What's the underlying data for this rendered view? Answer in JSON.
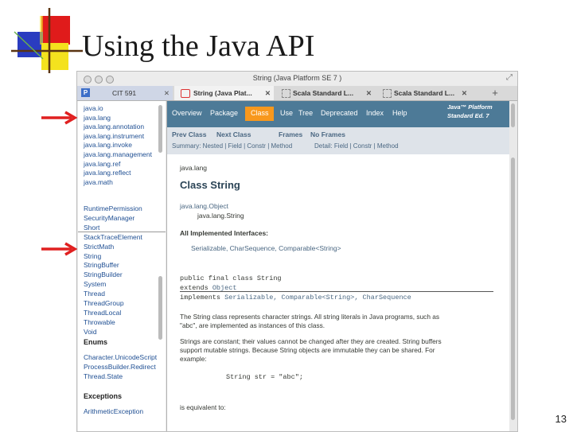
{
  "slide": {
    "title": "Using the Java API",
    "page_number": "13"
  },
  "browser": {
    "window_title": "String (Java Platform SE 7 )",
    "tabs": [
      {
        "label": "CIT 591"
      },
      {
        "label": "String (Java Plat..."
      },
      {
        "label": "Scala Standard L..."
      },
      {
        "label": "Scala Standard L..."
      }
    ],
    "new_tab": "+",
    "package_list": [
      "java.io",
      "java.lang",
      "java.lang.annotation",
      "java.lang.instrument",
      "java.lang.invoke",
      "java.lang.management",
      "java.lang.ref",
      "java.lang.reflect",
      "java.math"
    ],
    "class_list": [
      "RuntimePermission",
      "SecurityManager",
      "Short",
      "StackTraceElement",
      "StrictMath",
      "String",
      "StringBuffer",
      "StringBuilder",
      "System",
      "Thread",
      "ThreadGroup",
      "ThreadLocal",
      "Throwable",
      "Void"
    ],
    "enums_heading": "Enums",
    "enum_list": [
      "Character.UnicodeScript",
      "ProcessBuilder.Redirect",
      "Thread.State"
    ],
    "exceptions_heading": "Exceptions",
    "exception_list": [
      "ArithmeticException"
    ],
    "nav": {
      "items": [
        "Overview",
        "Package",
        "Class",
        "Use",
        "Tree",
        "Deprecated",
        "Index",
        "Help"
      ],
      "brand_line1": "Java™ Platform",
      "brand_line2": "Standard Ed. 7"
    },
    "subnav": {
      "prev_class": "Prev Class",
      "next_class": "Next Class",
      "frames": "Frames",
      "no_frames": "No Frames",
      "summary": "Summary: Nested | Field | Constr | Method",
      "detail": "Detail: Field | Constr | Method"
    },
    "doc": {
      "package": "java.lang",
      "class_title": "Class String",
      "hierarchy_1": "java.lang.Object",
      "hierarchy_2": "java.lang.String",
      "interfaces_heading": "All Implemented Interfaces:",
      "interfaces": "Serializable, CharSequence, Comparable<String>",
      "decl_1": "public final class String",
      "decl_2_kw": "extends",
      "decl_2_val": "Object",
      "decl_3_kw": "implements",
      "decl_3_val": "Serializable, Comparable<String>, CharSequence",
      "para1_line1": "The String class represents character strings. All string literals in Java programs, such as",
      "para1_line2": "\"abc\", are implemented as instances of this class.",
      "para2_line1": "Strings are constant; their values cannot be changed after they are created. String buffers",
      "para2_line2": "support mutable strings. Because String objects are immutable they can be shared. For",
      "para2_line3": "example:",
      "code_example": "String str = \"abc\";",
      "equivalent": "is equivalent to:"
    }
  },
  "colors": {
    "nav_bg": "#4d7a97",
    "nav_active": "#f8981d",
    "subnav_bg": "#dee3e9",
    "link": "#4a6782",
    "arrow": "#e02020"
  }
}
